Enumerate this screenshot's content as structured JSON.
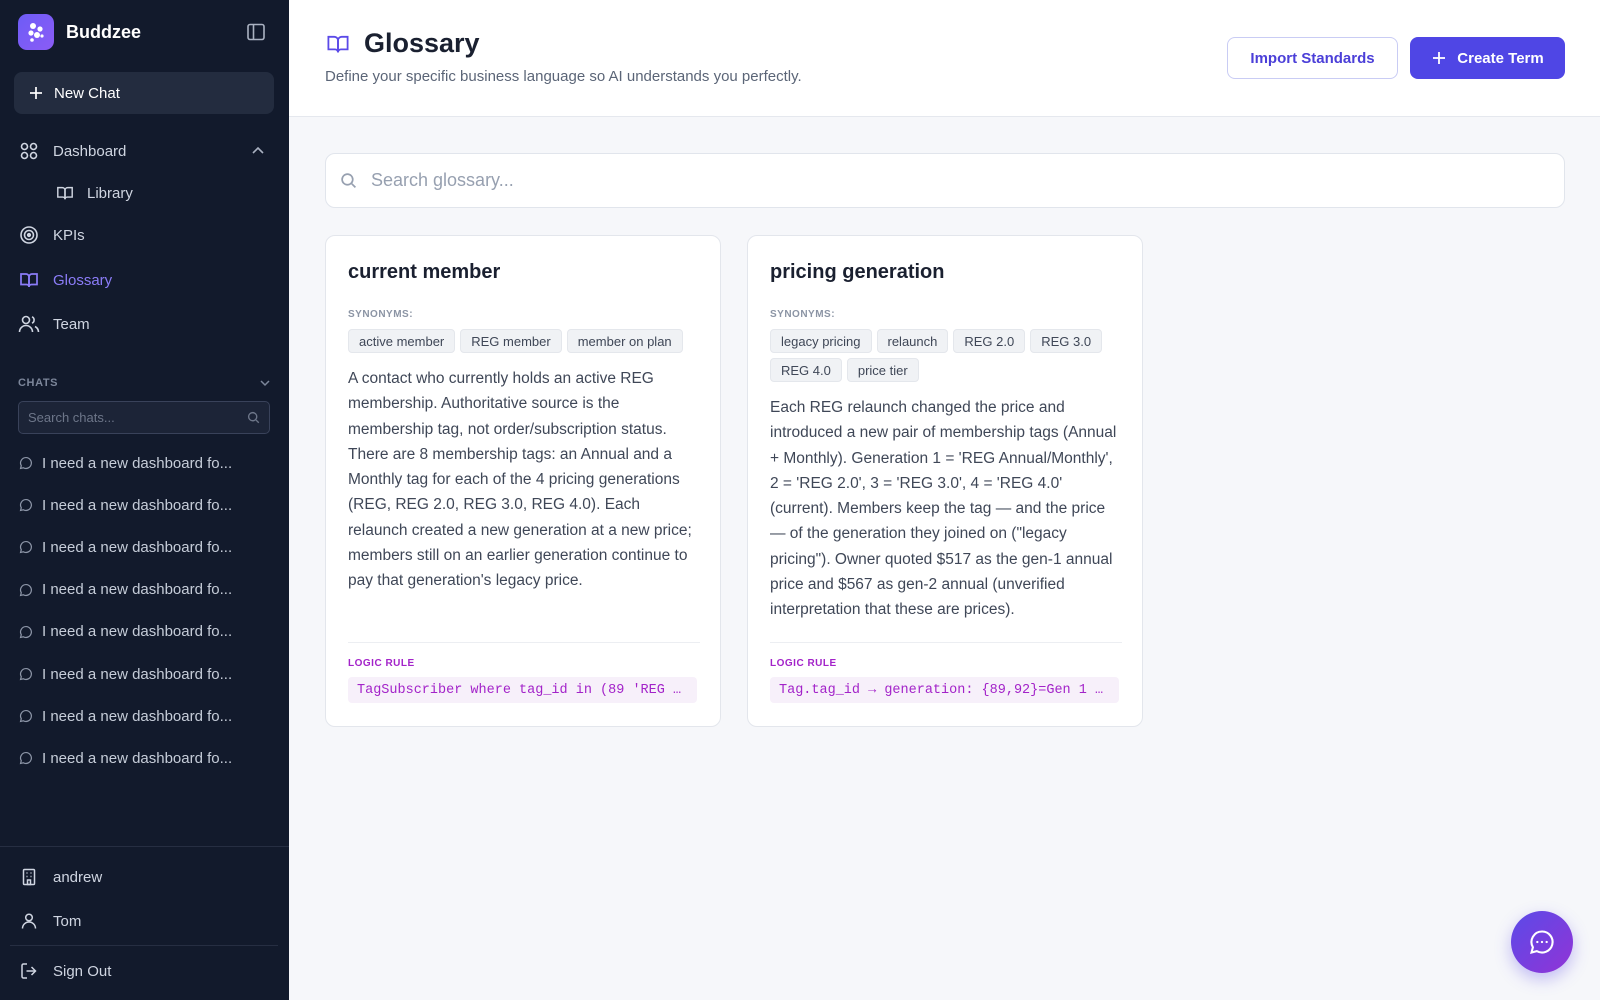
{
  "brand": {
    "name": "Buddzee",
    "logo_icon": "buddzee-logo-icon"
  },
  "sidebar": {
    "new_chat_label": "New Chat",
    "nav": {
      "dashboard": "Dashboard",
      "library": "Library",
      "kpis": "KPIs",
      "glossary": "Glossary",
      "team": "Team"
    },
    "chats_heading": "CHATS",
    "chat_search_placeholder": "Search chats...",
    "chats": [
      "I need a new dashboard fo...",
      "I need a new dashboard fo...",
      "I need a new dashboard fo...",
      "I need a new dashboard fo...",
      "I need a new dashboard fo...",
      "I need a new dashboard fo...",
      "I need a new dashboard fo...",
      "I need a new dashboard fo..."
    ],
    "footer": {
      "org": "andrew",
      "user": "Tom",
      "sign_out": "Sign Out"
    }
  },
  "header": {
    "title": "Glossary",
    "subtitle": "Define your specific business language so AI understands you perfectly.",
    "import_label": "Import Standards",
    "create_label": "Create Term"
  },
  "search": {
    "placeholder": "Search glossary..."
  },
  "labels": {
    "synonyms": "SYNONYMS:",
    "logic_rule": "LOGIC RULE"
  },
  "terms": [
    {
      "title": "current member",
      "synonyms": [
        "active member",
        "REG member",
        "member on plan"
      ],
      "description": "A contact who currently holds an active REG membership. Authoritative source is the membership tag, not order/subscription status. There are 8 membership tags: an Annual and a Monthly tag for each of the 4 pricing generations (REG, REG 2.0, REG 3.0, REG 4.0). Each relaunch created a new generation at a new price; members still on an earlier generation continue to pay that generation's legacy price.",
      "logic_rule": "TagSubscriber where tag_id in (89 'REG A…"
    },
    {
      "title": "pricing generation",
      "synonyms": [
        "legacy pricing",
        "relaunch",
        "REG 2.0",
        "REG 3.0",
        "REG 4.0",
        "price tier"
      ],
      "description": "Each REG relaunch changed the price and introduced a new pair of membership tags (Annual + Monthly). Generation 1 = 'REG Annual/Monthly', 2 = 'REG 2.0', 3 = 'REG 3.0', 4 = 'REG 4.0' (current). Members keep the tag — and the price — of the generation they joined on (\"legacy pricing\"). Owner quoted $517 as the gen-1 annual price and $567 as gen-2 annual (unverified interpretation that these are prices).",
      "logic_rule": "Tag.tag_id → generation: {89,92}=Gen 1 (…"
    }
  ],
  "colors": {
    "sidebar_bg": "#121a2c",
    "accent": "#4f46e5",
    "active_nav": "#8b7cf8",
    "logic_rule": "#a323c9"
  }
}
